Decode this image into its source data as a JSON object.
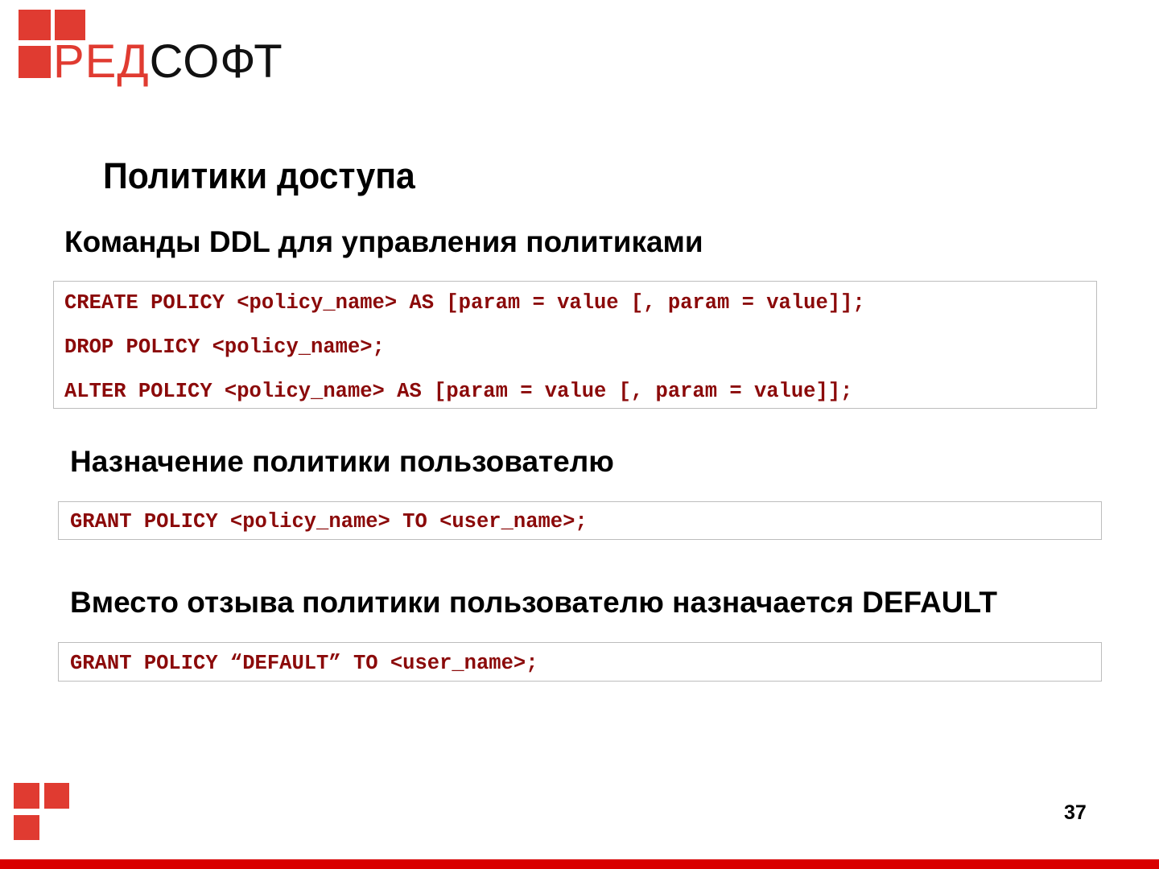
{
  "logo": {
    "text_red": "РЕД",
    "text_black": "СОФТ",
    "brand_color": "#e03b31",
    "icon": "three-squares-logo-icon"
  },
  "slide": {
    "title": "Политики доступа",
    "page_number": "37"
  },
  "sections": [
    {
      "heading": "Команды DDL для управления политиками",
      "code": [
        "CREATE POLICY <policy_name> AS [param = value [, param = value]];",
        "DROP POLICY <policy_name>;",
        "ALTER POLICY <policy_name> AS [param = value [, param = value]];"
      ]
    },
    {
      "heading": "Назначение политики пользователю",
      "code": [
        "GRANT POLICY <policy_name> TO <user_name>;"
      ]
    },
    {
      "heading": "Вместо отзыва политики пользователю назначается DEFAULT",
      "code": [
        "GRANT POLICY “DEFAULT” TO <user_name>;"
      ]
    }
  ],
  "colors": {
    "code_text": "#8b0a0a",
    "footer_bar": "#d90000",
    "box_border": "#bdbdbd"
  }
}
